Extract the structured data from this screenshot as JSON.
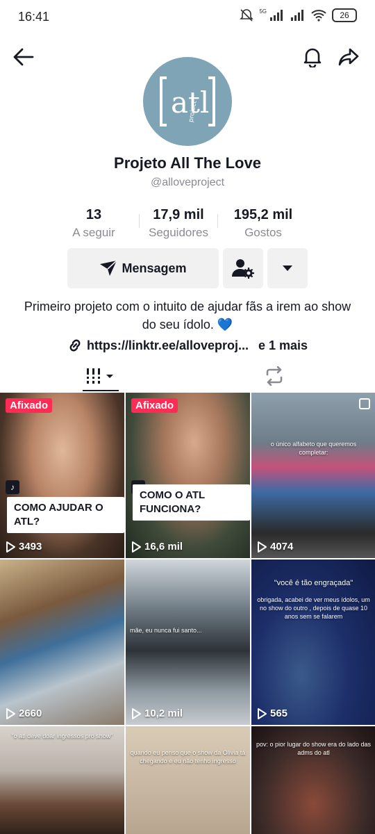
{
  "status_bar": {
    "time": "16:41",
    "network": "5G",
    "battery": "26"
  },
  "profile": {
    "name": "Projeto All The Love",
    "handle": "@alloveproject",
    "avatar_text": "atl",
    "avatar_sub": "project"
  },
  "stats": [
    {
      "value": "13",
      "label": "A seguir"
    },
    {
      "value": "17,9 mil",
      "label": "Seguidores"
    },
    {
      "value": "195,2 mil",
      "label": "Gostos"
    }
  ],
  "actions": {
    "message_label": "Mensagem"
  },
  "bio": {
    "text": "Primeiro projeto com o intuito de ajudar fãs a irem ao show do seu ídolo. 💙",
    "link": "https://linktr.ee/alloveproj...",
    "link_more": "e 1 mais"
  },
  "videos": [
    {
      "views": "3493",
      "pinned": "Afixado",
      "caption": "COMO AJUDAR O ATL?",
      "bg": "#8a6a5a"
    },
    {
      "views": "16,6 mil",
      "pinned": "Afixado",
      "caption": "COMO O ATL FUNCIONA?",
      "bg": "#6c5a4e"
    },
    {
      "views": "4074",
      "overlay": "o único alfabeto que queremos completar:",
      "bg": "#7b8a97"
    },
    {
      "views": "2660",
      "overlay": "",
      "bg": "#5d4f45"
    },
    {
      "views": "10,2 mil",
      "overlay": "mãe, eu nunca fui santo...",
      "bg": "#6f7d87"
    },
    {
      "views": "565",
      "overlay_title": "\"você é tão engraçada\"",
      "overlay": "obrigada, acabei de ver meus ídolos, um no show do outro , depois de quase 10 anos sem se falarem",
      "bg": "#1f2f6a"
    },
    {
      "views": "",
      "overlay": "\"o atl deve doar ingressos pro show\"",
      "bg": "#b9b1a9"
    },
    {
      "views": "",
      "overlay": "quando eu penso que o show da Olivia tá chegando e eu não tenho ingresso",
      "bg": "#c9b9a4"
    },
    {
      "views": "",
      "overlay": "pov: o pior lugar do show era do lado das adms do atl",
      "bg": "#3a2a28"
    }
  ]
}
